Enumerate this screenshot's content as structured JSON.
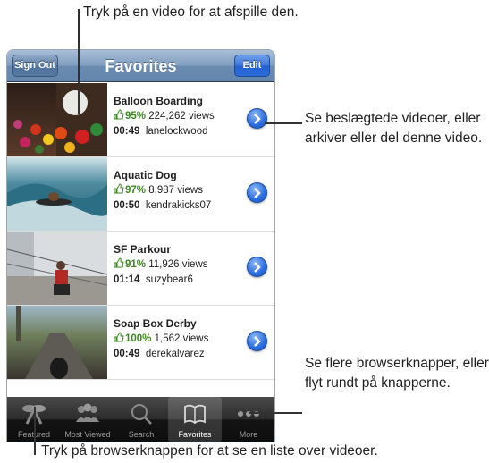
{
  "callouts": {
    "top": "Tryk på en video for at afspille den.",
    "right1": "Se beslægtede videoer, eller arkiver eller del denne video.",
    "right2": "Se flere browserknapper, eller flyt rundt på knapperne.",
    "bottom": "Tryk på browserknappen for at se en liste over videoer."
  },
  "navbar": {
    "title": "Favorites",
    "left_button": "Sign Out",
    "right_button": "Edit"
  },
  "videos": [
    {
      "title": "Balloon Boarding",
      "rating": "95%",
      "views": "224,262 views",
      "duration": "00:49",
      "user": "lanelockwood"
    },
    {
      "title": "Aquatic Dog",
      "rating": "97%",
      "views": "8,987 views",
      "duration": "00:50",
      "user": "kendrakicks07"
    },
    {
      "title": "SF Parkour",
      "rating": "91%",
      "views": "11,926 views",
      "duration": "01:14",
      "user": "suzybear6"
    },
    {
      "title": "Soap Box Derby",
      "rating": "100%",
      "views": "1,562 views",
      "duration": "00:49",
      "user": "derekalvarez"
    }
  ],
  "tabbar": {
    "tabs": [
      {
        "label": "Featured",
        "icon": "featured-icon"
      },
      {
        "label": "Most Viewed",
        "icon": "most-viewed-icon"
      },
      {
        "label": "Search",
        "icon": "search-icon"
      },
      {
        "label": "Favorites",
        "icon": "favorites-book-icon",
        "active": true
      },
      {
        "label": "More",
        "icon": "more-dots-icon"
      }
    ]
  },
  "colors": {
    "nav_blue": "#6b8bb1",
    "edit_blue": "#2d6bd8",
    "rating_green": "#3a8a1e",
    "tabbar": "#141414"
  }
}
